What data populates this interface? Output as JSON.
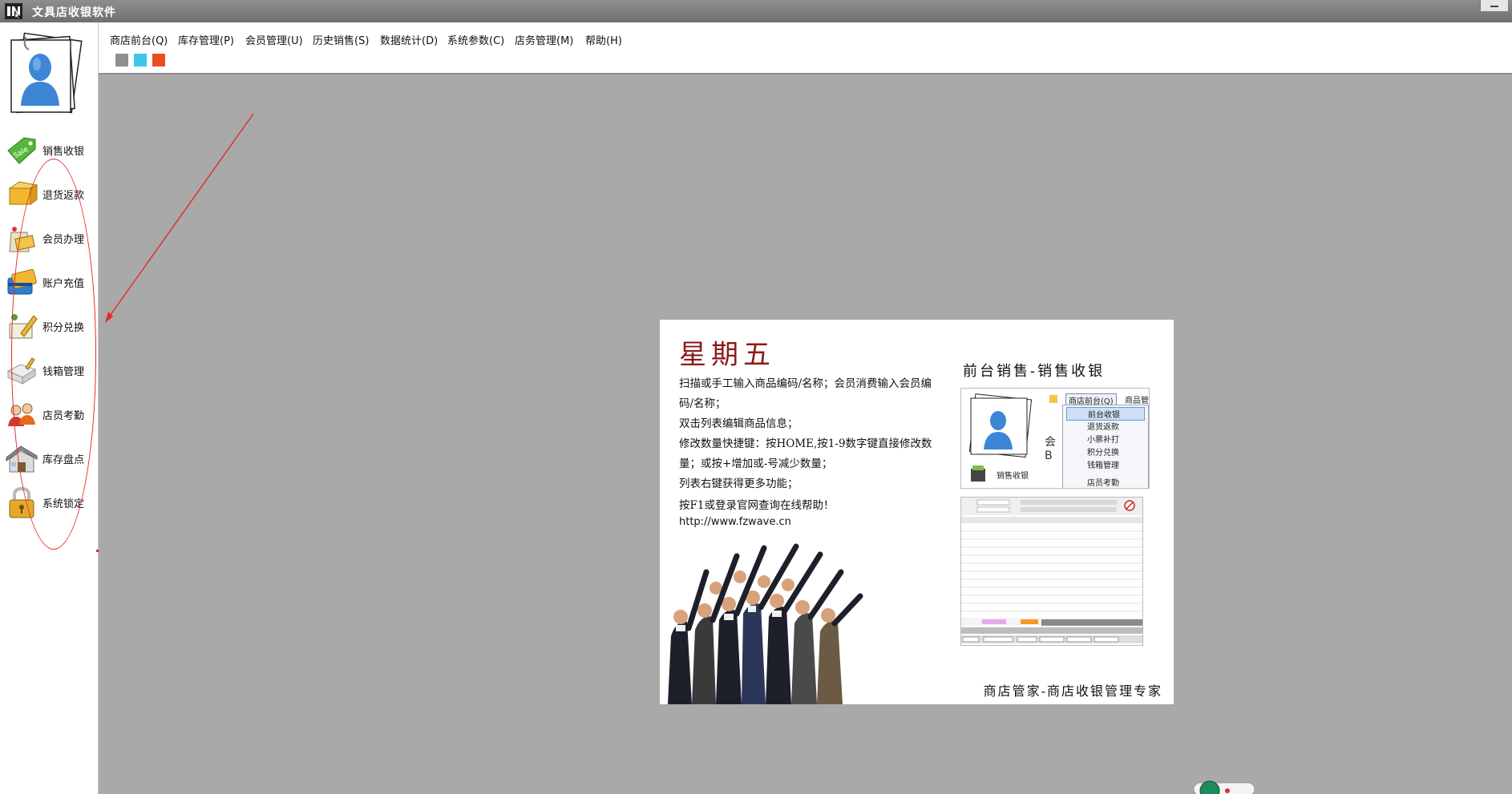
{
  "window": {
    "title": "文具店收银软件"
  },
  "menu": {
    "items": [
      "商店前台(Q)",
      "库存管理(P)",
      "会员管理(U)",
      "历史销售(S)",
      "数据统计(D)",
      "系统参数(C)",
      "店务管理(M)",
      "帮助(H)"
    ],
    "theme_swatches": [
      "#8f8f8f",
      "#3ec5ee",
      "#ee4b1f"
    ]
  },
  "sidebar": {
    "items": [
      {
        "label": "销售收银",
        "icon": "sale-tag-icon"
      },
      {
        "label": "退货返款",
        "icon": "return-goods-icon"
      },
      {
        "label": "会员办理",
        "icon": "member-card-icon"
      },
      {
        "label": "账户充值",
        "icon": "wallet-card-icon"
      },
      {
        "label": "积分兑换",
        "icon": "points-exchange-icon"
      },
      {
        "label": "钱箱管理",
        "icon": "cash-box-icon"
      },
      {
        "label": "店员考勤",
        "icon": "staff-attendance-icon"
      },
      {
        "label": "库存盘点",
        "icon": "warehouse-icon"
      },
      {
        "label": "系统锁定",
        "icon": "padlock-icon"
      }
    ]
  },
  "splash": {
    "day": "星期五",
    "tips": [
      "扫描或手工输入商品编码/名称；会员消费输入会员编码/名称；",
      "双击列表编辑商品信息；",
      "修改数量快捷键：按HOME,按1-9数字键直接修改数量；或按+增加或-号减少数量；",
      "列表右键获得更多功能；",
      "按F1或登录官网查询在线帮助！"
    ],
    "url": "http://www.fzwave.cn",
    "right_title": "前台销售-销售收银",
    "footer": "商店管家-商店收银管理专家",
    "mini_menu": {
      "header": "商店前台(Q)",
      "header2": "商品管",
      "items": [
        "前台收银",
        "退货返款",
        "小票补打",
        "积分兑换",
        "钱箱管理",
        "店员考勤"
      ],
      "side_label": "销售收银"
    }
  },
  "colors": {
    "annotation_red": "#e42a2a",
    "day_red": "#8b1a1a"
  }
}
